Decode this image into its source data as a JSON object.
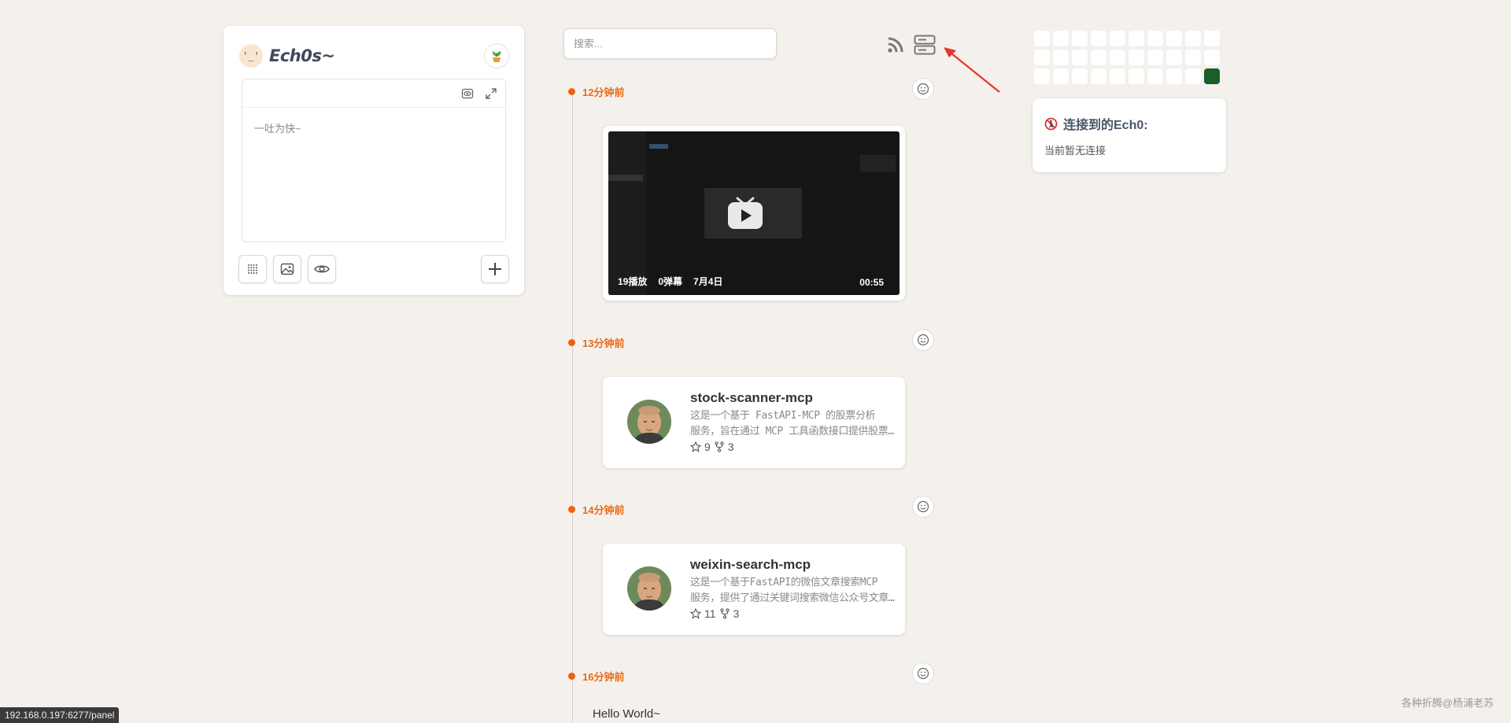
{
  "app": {
    "title": "Ech0s~",
    "avatar_text": "'_'",
    "accent_color": "#f0600f"
  },
  "editor": {
    "placeholder": "一吐为快~",
    "toolbar_icons": [
      "preview-icon",
      "fullscreen-icon"
    ],
    "action_icons": [
      "grid-icon",
      "image-icon",
      "eye-icon",
      "plus-icon"
    ]
  },
  "search": {
    "placeholder": "搜索..."
  },
  "header_icons": [
    "rss-icon",
    "server-icon"
  ],
  "timeline": [
    {
      "time": "12分钟前",
      "type": "video",
      "video": {
        "plays": "19播放",
        "danmaku": "0弹幕",
        "date": "7月4日",
        "duration": "00:55"
      }
    },
    {
      "time": "13分钟前",
      "type": "repo",
      "repo": {
        "name": "stock-scanner-mcp",
        "desc_line1": "这是一个基于 FastAPI-MCP 的股票分析",
        "desc_line2": "服务，旨在通过 MCP 工具函数接口提供股票分析…",
        "stars": "9",
        "forks": "3"
      }
    },
    {
      "time": "14分钟前",
      "type": "repo",
      "repo": {
        "name": "weixin-search-mcp",
        "desc_line1": "这是一个基于FastAPI的微信文章搜索MCP",
        "desc_line2": "服务，提供了通过关键词搜索微信公众号文章…",
        "stars": "11",
        "forks": "3"
      }
    },
    {
      "time": "16分钟前",
      "type": "text",
      "text": "Hello World~"
    }
  ],
  "heatmap": {
    "rows": 3,
    "cols": 10,
    "active_index": 29,
    "active_color": "#1a5e2a"
  },
  "connect": {
    "title": "连接到的Ech0:",
    "status": "当前暂无连接"
  },
  "status_bar": {
    "url": "192.168.0.197:6277/panel"
  },
  "footer": {
    "text": "各种折腾@杨浦老苏"
  }
}
